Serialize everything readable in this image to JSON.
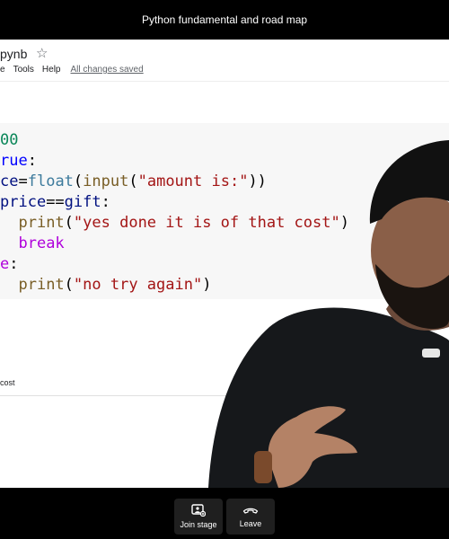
{
  "meeting": {
    "title": "Python fundamental and road map"
  },
  "notebook": {
    "name": "pynb",
    "menu": [
      "e",
      "Tools",
      "Help"
    ],
    "saved_status": "All changes saved"
  },
  "code_lines": [
    [
      {
        "t": "00",
        "c": "num"
      }
    ],
    [
      {
        "t": "rue",
        "c": "kw"
      },
      {
        "t": ":",
        "c": "plain"
      }
    ],
    [
      {
        "t": "ce",
        "c": "var"
      },
      {
        "t": "=",
        "c": "plain"
      },
      {
        "t": "float",
        "c": "fn2"
      },
      {
        "t": "(",
        "c": "plain"
      },
      {
        "t": "input",
        "c": "fn"
      },
      {
        "t": "(",
        "c": "plain"
      },
      {
        "t": "\"amount is:\"",
        "c": "str"
      },
      {
        "t": "))",
        "c": "plain"
      }
    ],
    [
      {
        "t": "price",
        "c": "var"
      },
      {
        "t": "==",
        "c": "plain"
      },
      {
        "t": "gift",
        "c": "var"
      },
      {
        "t": ":",
        "c": "plain"
      }
    ],
    [
      {
        "t": "  ",
        "c": "plain"
      },
      {
        "t": "print",
        "c": "fn"
      },
      {
        "t": "(",
        "c": "plain"
      },
      {
        "t": "\"yes done it is of that cost\"",
        "c": "str"
      },
      {
        "t": ")",
        "c": "plain"
      }
    ],
    [
      {
        "t": "  ",
        "c": "plain"
      },
      {
        "t": "break",
        "c": "kw2"
      }
    ],
    [
      {
        "t": "e",
        "c": "kw2"
      },
      {
        "t": ":",
        "c": "plain"
      }
    ],
    [
      {
        "t": "  ",
        "c": "plain"
      },
      {
        "t": "print",
        "c": "fn"
      },
      {
        "t": "(",
        "c": "plain"
      },
      {
        "t": "\"no try again\"",
        "c": "str"
      },
      {
        "t": ")",
        "c": "plain"
      }
    ]
  ],
  "output_text": "cost",
  "controls": {
    "join_stage": {
      "label": "Join stage",
      "icon": "join-stage-icon"
    },
    "leave": {
      "label": "Leave",
      "icon": "leave-call-icon"
    }
  },
  "colors": {
    "background": "#000000",
    "cell_bg": "#f7f7f7",
    "button_bg": "#1f1f1f"
  }
}
